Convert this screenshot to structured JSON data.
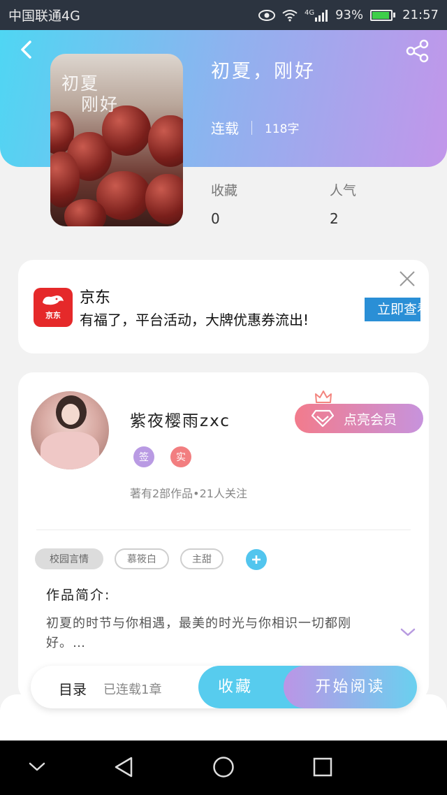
{
  "status_bar": {
    "carrier": "中国联通4G",
    "signal_label": "4G",
    "battery": "93%",
    "time": "21:57"
  },
  "book": {
    "title": "初夏，刚好",
    "status": "连载",
    "word_count": "118字",
    "cover_title_line1": "初夏",
    "cover_title_line2": "刚好",
    "stats": {
      "favorites_label": "收藏",
      "favorites": "0",
      "popularity_label": "人气",
      "popularity": "2"
    }
  },
  "ad": {
    "brand": "京东",
    "logo_text": "京东",
    "description": "有福了，平台活动，大牌优惠券流出!",
    "cta": "立即查看"
  },
  "author": {
    "name": "紫夜樱雨zxc",
    "badges": [
      {
        "text": "签",
        "color": "#b99ae3"
      },
      {
        "text": "实",
        "color": "#f27e80"
      }
    ],
    "stats": "著有2部作品•21人关注",
    "vip_button": "点亮会员"
  },
  "tags": [
    "校园言情",
    "慕筱白",
    "主甜"
  ],
  "intro": {
    "label": "作品简介:",
    "text": "初夏的时节与你相遇，最美的时光与你相识一切都刚好。…"
  },
  "bottom_bar": {
    "toc": "目录",
    "serial": "已连载1章",
    "favorite": "收藏",
    "read": "开始阅读"
  },
  "colors": {
    "brand_blue": "#4fd6f3",
    "brand_purple": "#c296ea",
    "jd_red": "#e5292a"
  }
}
